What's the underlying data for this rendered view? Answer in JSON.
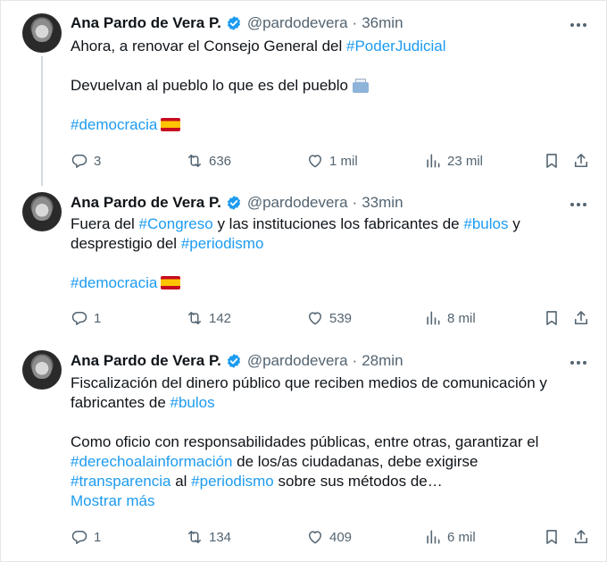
{
  "tweets": [
    {
      "author": "Ana Pardo de Vera P.",
      "handle": "@pardodevera",
      "separator": "·",
      "time": "36min",
      "lines": [
        [
          {
            "t": "Ahora, a renovar el Consejo General del "
          },
          {
            "t": "#PoderJudicial",
            "c": "tag"
          }
        ],
        [],
        [
          {
            "t": "Devuelvan al pueblo lo que es del pueblo"
          },
          {
            "emoji": "ballot-box-icon"
          }
        ],
        [],
        [
          {
            "t": "#democracia",
            "c": "tag"
          },
          {
            "emoji": "spain-flag-icon"
          }
        ]
      ],
      "replies": "3",
      "reposts": "636",
      "likes": "1 mil",
      "views": "23 mil"
    },
    {
      "author": "Ana Pardo de Vera P.",
      "handle": "@pardodevera",
      "separator": "·",
      "time": "33min",
      "lines": [
        [
          {
            "t": "Fuera del "
          },
          {
            "t": "#Congreso",
            "c": "tag"
          },
          {
            "t": " y las instituciones los fabricantes de "
          },
          {
            "t": "#bulos",
            "c": "tag"
          },
          {
            "t": " y"
          }
        ],
        [
          {
            "t": "desprestigio del "
          },
          {
            "t": "#periodismo",
            "c": "tag"
          }
        ],
        [],
        [
          {
            "t": "#democracia",
            "c": "tag"
          },
          {
            "emoji": "spain-flag-icon"
          }
        ]
      ],
      "replies": "1",
      "reposts": "142",
      "likes": "539",
      "views": "8 mil"
    },
    {
      "author": "Ana Pardo de Vera P.",
      "handle": "@pardodevera",
      "separator": "·",
      "time": "28min",
      "lines": [
        [
          {
            "t": "Fiscalización del dinero público que reciben medios de comunicación y"
          }
        ],
        [
          {
            "t": "fabricantes de "
          },
          {
            "t": "#bulos",
            "c": "tag"
          }
        ],
        [],
        [
          {
            "t": "Como oficio con responsabilidades públicas, entre otras, garantizar el"
          }
        ],
        [
          {
            "t": "#derechoalainformación",
            "c": "tag"
          },
          {
            "t": " de los/as ciudadanas, debe exigirse"
          }
        ],
        [
          {
            "t": "#transparencia",
            "c": "tag"
          },
          {
            "t": " al "
          },
          {
            "t": "#periodismo",
            "c": "tag"
          },
          {
            "t": " sobre sus métodos de…"
          }
        ],
        [
          {
            "t": "Mostrar más",
            "c": "link"
          }
        ]
      ],
      "replies": "1",
      "reposts": "134",
      "likes": "409",
      "views": "6 mil"
    }
  ],
  "icons": {
    "reply": "reply-icon",
    "repost": "repost-icon",
    "like": "heart-icon",
    "views": "views-icon",
    "bookmark": "bookmark-icon",
    "share": "share-icon",
    "verified": "verified-badge-icon",
    "more": "more-options-icon"
  },
  "colors": {
    "accent": "#1d9bf0",
    "text": "#0f1419",
    "secondary": "#536471",
    "thread_line": "#cfd9de"
  }
}
